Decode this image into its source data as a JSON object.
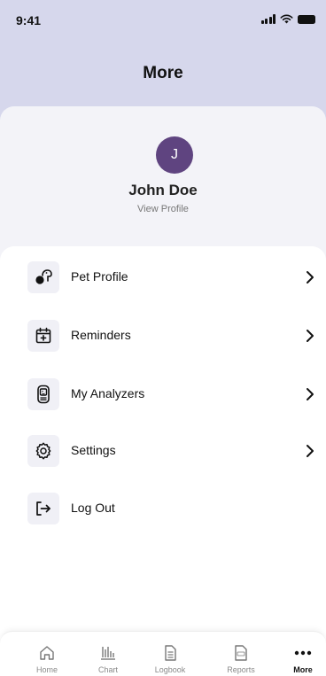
{
  "status_bar": {
    "time": "9:41"
  },
  "header": {
    "title": "More"
  },
  "profile": {
    "initial": "J",
    "name": "John Doe",
    "view_profile_label": "View Profile",
    "avatar_color": "#5f4480"
  },
  "menu": {
    "items": [
      {
        "label": "Pet Profile",
        "icon": "pet-icon",
        "has_chevron": true
      },
      {
        "label": "Reminders",
        "icon": "calendar-add-icon",
        "has_chevron": true
      },
      {
        "label": "My Analyzers",
        "icon": "analyzer-device-icon",
        "has_chevron": true
      },
      {
        "label": "Settings",
        "icon": "gear-icon",
        "has_chevron": true
      },
      {
        "label": "Log Out",
        "icon": "logout-icon",
        "has_chevron": false
      }
    ]
  },
  "tab_bar": {
    "tabs": [
      {
        "label": "Home",
        "icon": "home-icon",
        "active": false
      },
      {
        "label": "Chart",
        "icon": "chart-icon",
        "active": false
      },
      {
        "label": "Logbook",
        "icon": "document-icon",
        "active": false
      },
      {
        "label": "Reports",
        "icon": "pdf-icon",
        "active": false
      },
      {
        "label": "More",
        "icon": "more-dots-icon",
        "active": true
      }
    ]
  },
  "colors": {
    "header_bg": "#d6d7ec",
    "profile_bg": "#f3f3f8",
    "icon_box_bg": "#f0f0f6"
  }
}
